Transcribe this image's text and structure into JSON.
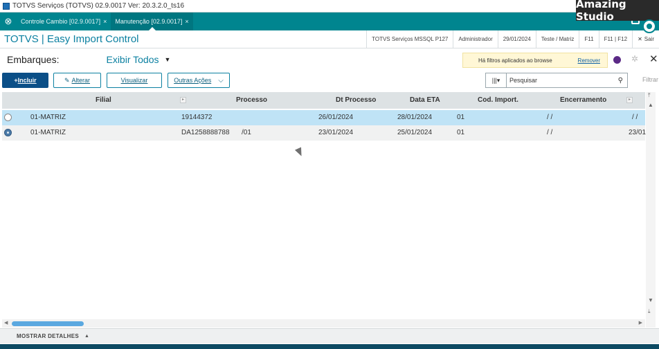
{
  "window": {
    "title": "TOTVS Serviços (TOTVS) 02.9.0017    Ver: 20.3.2.0_ts16",
    "watermark": "Amazing Studio"
  },
  "tabs": [
    {
      "label": "Controle Cambio [02.9.0017]",
      "close": "×"
    },
    {
      "label": "Manutenção [02.9.0017]",
      "close": "×"
    }
  ],
  "header": {
    "title": "TOTVS | Easy Import Control",
    "info": [
      "TOTVS Serviços MSSQL P127",
      "Administrador",
      "29/01/2024",
      "Teste / Matriz",
      "F11",
      "F11 | F12",
      "Sair"
    ]
  },
  "embarques": {
    "label": "Embarques:",
    "view_selected": "Exibir Todos",
    "filter_message": "Há filtros aplicados ao browse",
    "remove_label": "Remover"
  },
  "toolbar": {
    "incluir": "Incluir",
    "alterar": "Alterar",
    "visualizar": "Visualizar",
    "outras": "Outras Ações",
    "search_placeholder": "Pesquisar",
    "filtrar": "Filtrar"
  },
  "grid": {
    "columns": [
      "Filial",
      "Processo",
      "Dt Processo",
      "Data ETA",
      "Cod. Import.",
      "Encerramento"
    ],
    "rows": [
      {
        "filial": "01-MATRIZ",
        "processo": "19144372",
        "processo_suffix": "",
        "dt_processo": "26/01/2024",
        "data_eta": "28/01/2024",
        "cod_import": "01",
        "encerramento": "/ /",
        "extra": "/ /"
      },
      {
        "filial": "01-MATRIZ",
        "processo": "DA1258888788",
        "processo_suffix": "/01",
        "dt_processo": "23/01/2024",
        "data_eta": "25/01/2024",
        "cod_import": "01",
        "encerramento": "/ /",
        "extra": "23/01"
      }
    ]
  },
  "footer": {
    "details": "MOSTRAR DETALHES"
  },
  "colors": {
    "teal": "#00858f",
    "accent": "#0b80a1",
    "selected_row": "#bfe3f6",
    "primary_button": "#0b4f87"
  }
}
